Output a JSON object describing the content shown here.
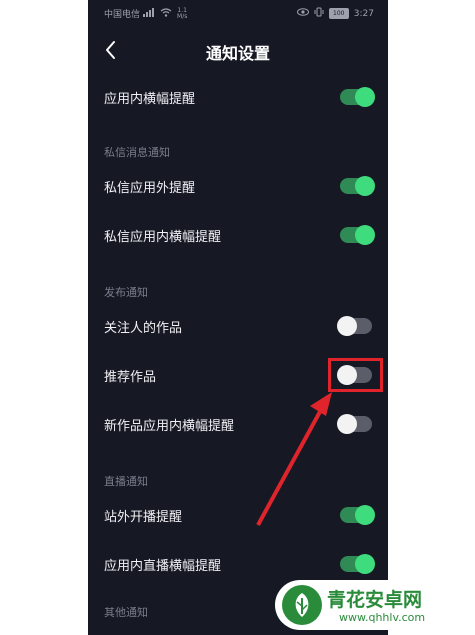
{
  "status_bar": {
    "carrier": "中国电信",
    "signal_text": "⁴ᴳ",
    "net_speed": "1.1\nM/s",
    "battery": "100",
    "time": "3:27"
  },
  "nav": {
    "back_icon": "chevron-left-icon",
    "title": "通知设置"
  },
  "settings": [
    {
      "type": "row",
      "label": "应用内横幅提醒",
      "enabled": true
    },
    {
      "type": "header",
      "label": "私信消息通知"
    },
    {
      "type": "row",
      "label": "私信应用外提醒",
      "enabled": true
    },
    {
      "type": "row",
      "label": "私信应用内横幅提醒",
      "enabled": true
    },
    {
      "type": "header",
      "label": "发布通知"
    },
    {
      "type": "row",
      "label": "关注人的作品",
      "enabled": false
    },
    {
      "type": "row",
      "label": "推荐作品",
      "enabled": false
    },
    {
      "type": "row",
      "label": "新作品应用内横幅提醒",
      "enabled": false
    },
    {
      "type": "header",
      "label": "直播通知"
    },
    {
      "type": "row",
      "label": "站外开播提醒",
      "enabled": true
    },
    {
      "type": "row",
      "label": "应用内直播横幅提醒",
      "enabled": true
    },
    {
      "type": "header",
      "label": "其他通知"
    }
  ],
  "colors": {
    "background": "#161824",
    "toggle_on": "#3fdc7e",
    "toggle_off": "#f3f3f3",
    "annotation": "#e0242c"
  },
  "watermark": {
    "title": "青花安卓网",
    "url": "www.qhhlv.com"
  }
}
